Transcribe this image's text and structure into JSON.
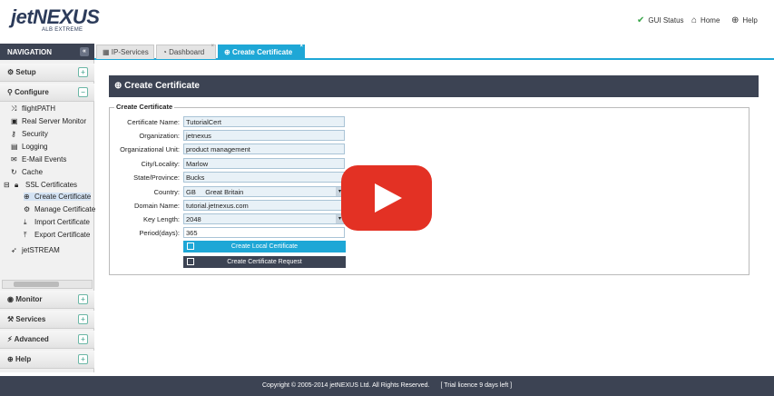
{
  "header": {
    "logo_main": "jetNEXUS",
    "logo_sub": "ALB EXTREME",
    "links": [
      {
        "label": "GUI Status",
        "icon": "check-circle-icon"
      },
      {
        "label": "Home",
        "icon": "home-icon"
      },
      {
        "label": "Help",
        "icon": "lifebuoy-icon"
      }
    ]
  },
  "sidebar": {
    "title": "NAVIGATION",
    "sections": {
      "setup": "Setup",
      "configure": "Configure",
      "monitor": "Monitor",
      "services": "Services",
      "advanced": "Advanced",
      "help": "Help"
    },
    "configure_items": [
      "flightPATH",
      "Real Server Monitor",
      "Security",
      "Logging",
      "E-Mail Events",
      "Cache",
      "SSL Certificates",
      "jetSTREAM"
    ],
    "ssl_items": [
      "Create Certificate",
      "Manage Certificate",
      "Import Certificate",
      "Export Certificate"
    ]
  },
  "tabs": [
    {
      "label": "IP-Services"
    },
    {
      "label": "Dashboard"
    },
    {
      "label": "Create Certificate",
      "active": true
    }
  ],
  "panel": {
    "title": "Create Certificate",
    "legend": "Create Certificate",
    "fields": [
      {
        "label": "Certificate Name:",
        "value": "TutorialCert"
      },
      {
        "label": "Organization:",
        "value": "jetnexus"
      },
      {
        "label": "Organizational Unit:",
        "value": "product management"
      },
      {
        "label": "City/Locality:",
        "value": "Marlow"
      },
      {
        "label": "State/Province:",
        "value": "Bucks"
      },
      {
        "label": "Country:",
        "value": "GB     Great Britain"
      },
      {
        "label": "Domain Name:",
        "value": "tutorial.jetnexus.com"
      },
      {
        "label": "Key Length:",
        "value": "2048"
      },
      {
        "label": "Period(days):",
        "value": "365"
      }
    ],
    "buttons": {
      "create_local": "Create Local Certificate",
      "create_request": "Create Certificate Request"
    }
  },
  "footer": {
    "copyright": "Copyright © 2005-2014 jetNEXUS Ltd. All Rights Reserved.",
    "trial": "[ Trial licence 9 days left ]"
  },
  "colors": {
    "accent": "#1ea7d6",
    "dark": "#3c4353",
    "play": "#e33124"
  }
}
